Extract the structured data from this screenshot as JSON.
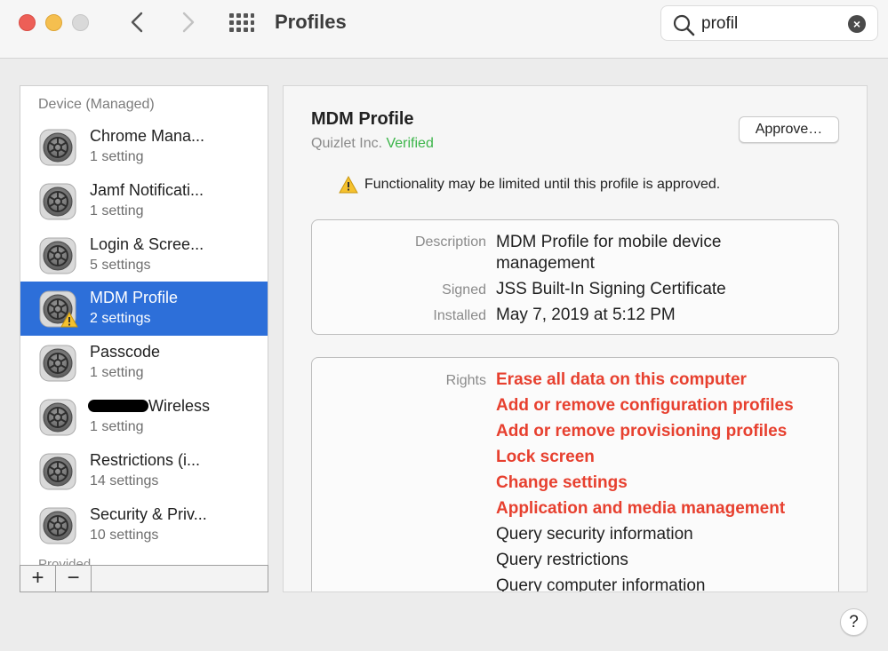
{
  "window": {
    "title": "Profiles"
  },
  "search": {
    "value": "profil",
    "clear_glyph": "×"
  },
  "sidebar": {
    "heading": "Device (Managed)",
    "items": [
      {
        "name": "Chrome Mana...",
        "sub": "1 setting"
      },
      {
        "name": "Jamf Notificati...",
        "sub": "1 setting"
      },
      {
        "name": "Login & Scree...",
        "sub": "5 settings"
      },
      {
        "name": "MDM Profile",
        "sub": "2 settings",
        "selected": true,
        "warning": true
      },
      {
        "name": "Passcode",
        "sub": "1 setting"
      },
      {
        "name": "Wireless",
        "sub": "1 setting",
        "redacted_prefix": true
      },
      {
        "name": "Restrictions (i...",
        "sub": "14 settings"
      },
      {
        "name": "Security & Priv...",
        "sub": "10 settings"
      }
    ],
    "cutoff_label": "Provided",
    "footer": {
      "add": "+",
      "remove": "−"
    }
  },
  "detail": {
    "title": "MDM Profile",
    "org": "Quizlet Inc.",
    "verified": "Verified",
    "approve_label": "Approve…",
    "warning_text": "Functionality may be limited until this profile is approved.",
    "info": {
      "description_label": "Description",
      "description_value": "MDM Profile for mobile device management",
      "signed_label": "Signed",
      "signed_value": "JSS Built-In Signing Certificate",
      "installed_label": "Installed",
      "installed_value": "May 7, 2019 at 5:12 PM"
    },
    "rights_label": "Rights",
    "rights_highlighted": [
      "Erase all data on this computer",
      "Add or remove configuration profiles",
      "Add or remove provisioning profiles",
      "Lock screen",
      "Change settings",
      "Application and media management"
    ],
    "rights_normal": [
      "Query security information",
      "Query restrictions",
      "Query computer information"
    ]
  },
  "help": {
    "label": "?"
  },
  "colors": {
    "selection": "#2d6fd9",
    "verified": "#3cb54a",
    "rights_red": "#e7402f"
  }
}
